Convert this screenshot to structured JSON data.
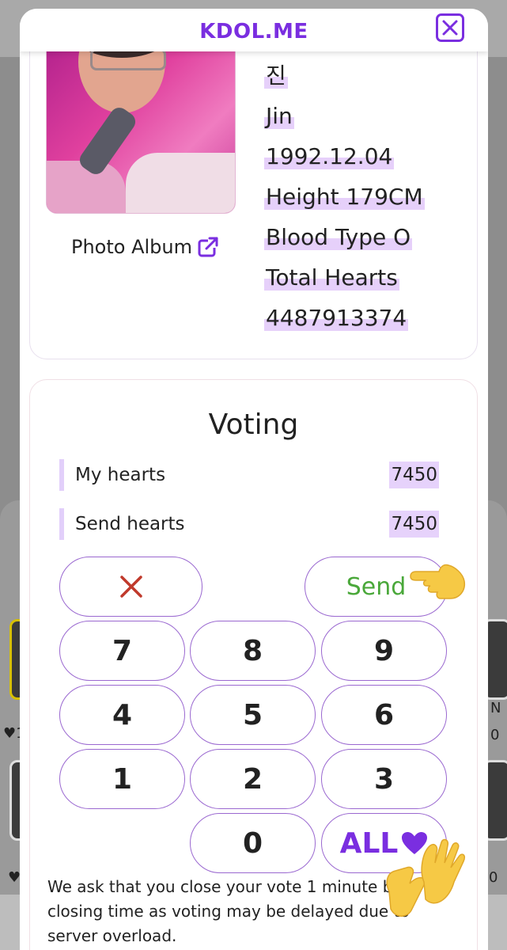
{
  "app": {
    "brand": "KDOL.ME"
  },
  "header": {
    "close_icon": "close-icon"
  },
  "profile": {
    "album_label": "Photo Album",
    "album_icon": "external-link-icon",
    "korean_name": "진",
    "name": "Jin",
    "birthdate": "1992.12.04",
    "height": "Height 179CM",
    "blood_type": "Blood Type O",
    "total_hearts_label": "Total Hearts",
    "total_hearts_value": "4487913374"
  },
  "voting": {
    "title": "Voting",
    "my_hearts_label": "My hearts",
    "my_hearts_value": "7450",
    "send_hearts_label": "Send hearts",
    "send_hearts_value": "7450",
    "clear_icon": "clear-x-icon",
    "send_label": "Send",
    "keys": [
      "7",
      "8",
      "9",
      "4",
      "5",
      "6",
      "1",
      "2",
      "3",
      "0"
    ],
    "all_label": "ALL",
    "all_icon": "heart-icon"
  },
  "notice": "We ask that you close your vote 1 minute before closing time as voting may be delayed due to server overload.",
  "background": {
    "left_heart_1": "♥1",
    "left_heart_2": "♥",
    "right_text_1": "N",
    "right_text_2": "0",
    "right_text_3": "0"
  },
  "colors": {
    "brand": "#7a2ee0",
    "highlight": "#e6d2fb",
    "send_green": "#4aa83a",
    "clear_red": "#c0392b"
  }
}
